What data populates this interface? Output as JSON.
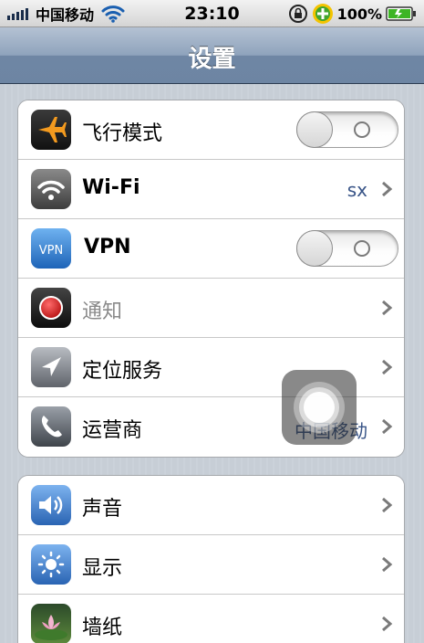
{
  "status_bar": {
    "carrier": "中国移动",
    "time": "23:10",
    "battery_percent": "100%",
    "battery_level": 1.0,
    "signal_bars": 5,
    "icons": [
      "signal-icon",
      "wifi-icon",
      "rotation-lock-icon",
      "app-badge-icon",
      "battery-icon"
    ]
  },
  "nav": {
    "title": "设置"
  },
  "group1": [
    {
      "label": "飞行模式",
      "icon": "airplane-icon",
      "control": "toggle",
      "toggle_on": false
    },
    {
      "label": "Wi-Fi",
      "icon": "wifi-icon",
      "value": "sx",
      "control": "chevron"
    },
    {
      "label": "VPN",
      "icon": "vpn-icon",
      "icon_text": "VPN",
      "control": "toggle",
      "toggle_on": false
    },
    {
      "label": "通知",
      "icon": "notifications-icon",
      "control": "chevron",
      "dimmed": true
    },
    {
      "label": "定位服务",
      "icon": "location-icon",
      "control": "chevron"
    },
    {
      "label": "运营商",
      "icon": "phone-icon",
      "value": "中国移动",
      "control": "chevron"
    }
  ],
  "group2": [
    {
      "label": "声音",
      "icon": "sound-icon",
      "control": "chevron"
    },
    {
      "label": "显示",
      "icon": "brightness-icon",
      "control": "chevron"
    },
    {
      "label": "墙纸",
      "icon": "wallpaper-icon",
      "control": "chevron"
    }
  ],
  "colors": {
    "nav_bar": "#7088a6",
    "value_text": "#385487",
    "airplane_icon_bg": "#f39a1f",
    "vpn_icon_bg": "#3c8ad6",
    "notifications_icon_dot": "#d91e1e"
  }
}
